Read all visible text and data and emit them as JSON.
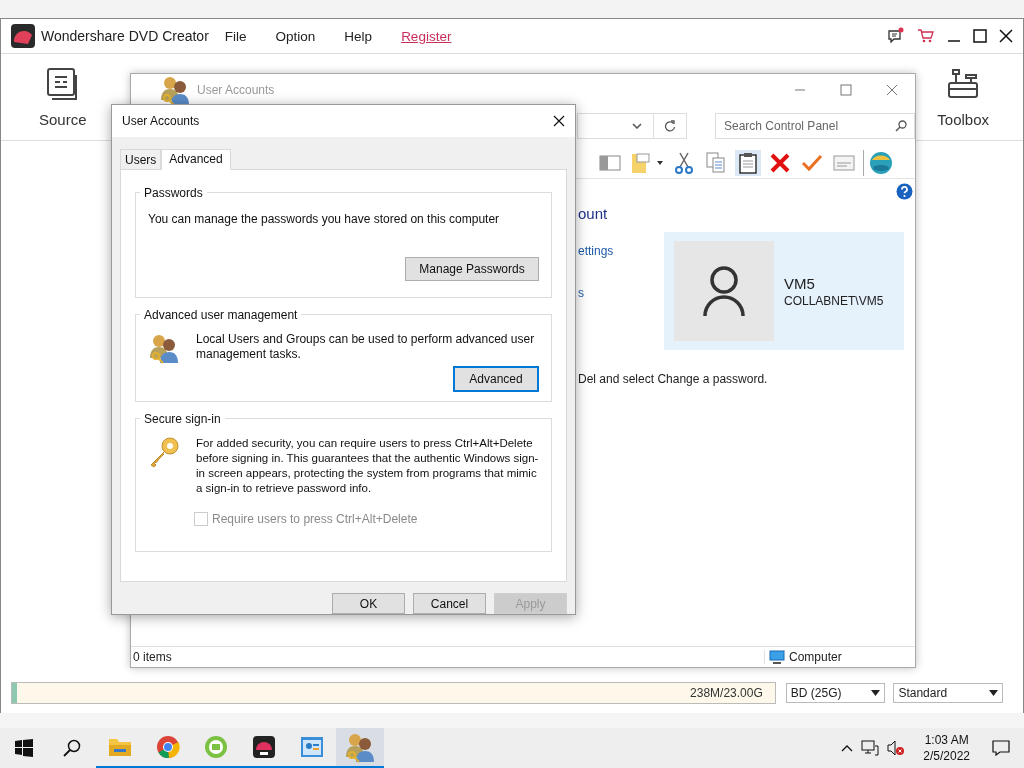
{
  "app": {
    "title": "Wondershare DVD Creator",
    "menu": [
      {
        "label": "File",
        "kind": "menu"
      },
      {
        "label": "Option",
        "kind": "menu"
      },
      {
        "label": "Help",
        "kind": "menu"
      },
      {
        "label": "Register",
        "kind": "link"
      }
    ],
    "toolbar": [
      {
        "label": "Source",
        "kind": "source"
      },
      {
        "label": "Toolbox",
        "kind": "toolbox"
      }
    ],
    "progress": {
      "level": 0.006,
      "reading": "238M/23.00G"
    },
    "disc_select": "BD (25G)",
    "quality_select": "Standard"
  },
  "control_panel": {
    "title": "User Accounts",
    "search": {
      "placeholder": "Search Control Panel"
    },
    "heading": "ount",
    "links": [
      "ettings",
      "s"
    ],
    "user": {
      "name": "VM5",
      "account": "COLLABNET\\VM5"
    },
    "note": "Del and select Change a password.",
    "status": {
      "items": "0 items",
      "location": "Computer"
    }
  },
  "dialog": {
    "title": "User Accounts",
    "tabs": [
      {
        "label": "Users",
        "selected": false
      },
      {
        "label": "Advanced",
        "selected": true
      }
    ],
    "groups": [
      {
        "kind": "passwords",
        "title": "Passwords",
        "text": "You can manage the passwords you have stored on this computer",
        "button": {
          "label": "Manage Passwords",
          "focused": false
        }
      },
      {
        "kind": "users",
        "title": "Advanced user management",
        "text": "Local Users and Groups can be used to perform advanced user management tasks.",
        "button": {
          "label": "Advanced",
          "focused": true
        }
      },
      {
        "kind": "secure",
        "title": "Secure sign-in",
        "text": "For added security, you can require users to press Ctrl+Alt+Delete before signing in. This guarantees that the authentic Windows sign-in screen appears, protecting the system from programs that mimic a sign-in to retrieve password info.",
        "checkbox": {
          "label": "Require users to press Ctrl+Alt+Delete",
          "checked": false,
          "disabled": true
        }
      }
    ],
    "buttons": [
      {
        "label": "OK",
        "disabled": false
      },
      {
        "label": "Cancel",
        "disabled": false
      },
      {
        "label": "Apply",
        "disabled": true
      }
    ]
  },
  "taskbar": {
    "apps": [
      {
        "kind": "folder",
        "selected": false
      },
      {
        "kind": "chrome",
        "selected": false
      },
      {
        "kind": "green",
        "selected": false
      },
      {
        "kind": "dvd",
        "selected": false
      },
      {
        "kind": "panel",
        "selected": false
      },
      {
        "kind": "users",
        "selected": true
      }
    ],
    "time": "1:03 AM",
    "date": "2/5/2022"
  }
}
